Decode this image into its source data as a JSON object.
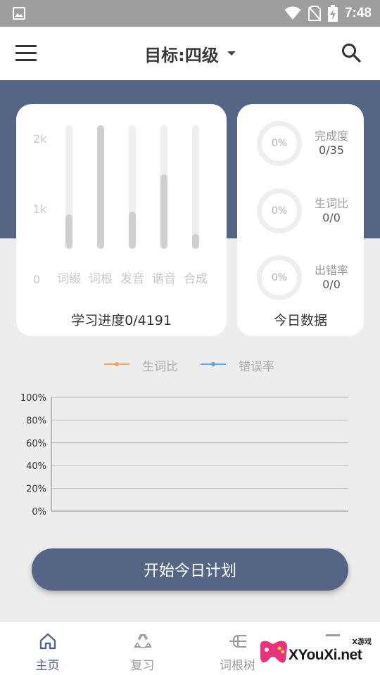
{
  "status_bar": {
    "time": "7:48",
    "icons": [
      "image-icon",
      "wifi-icon",
      "no-sim-icon",
      "battery-charging-icon"
    ]
  },
  "app_bar": {
    "menu_icon": "menu-icon",
    "title": "目标:四级",
    "dropdown_icon": "caret-down-icon",
    "search_icon": "search-icon"
  },
  "progress_card": {
    "y_ticks": [
      "2k",
      "1k",
      "0"
    ],
    "bars": [
      {
        "label": "词缀",
        "fraction": 0.28
      },
      {
        "label": "词根",
        "fraction": 1.0
      },
      {
        "label": "发音",
        "fraction": 0.3
      },
      {
        "label": "谐音",
        "fraction": 0.6
      },
      {
        "label": "合成",
        "fraction": 0.12
      }
    ],
    "caption": "学习进度0/4191"
  },
  "today_card": {
    "stats": [
      {
        "percent": "0%",
        "label": "完成度",
        "value": "0/35"
      },
      {
        "percent": "0%",
        "label": "生词比",
        "value": "0/0"
      },
      {
        "percent": "0%",
        "label": "出错率",
        "value": "0/0"
      }
    ],
    "caption": "今日数据"
  },
  "chart_data": {
    "type": "line",
    "series": [
      {
        "name": "生词比",
        "color": "#f0a35e",
        "values": []
      },
      {
        "name": "错误率",
        "color": "#5aa3e8",
        "values": []
      }
    ],
    "y_ticks": [
      "100%",
      "80%",
      "60%",
      "40%",
      "20%",
      "0%"
    ],
    "ylim": [
      0,
      100
    ],
    "grid": true,
    "legend": "top-center"
  },
  "start_button": {
    "label": "开始今日计划"
  },
  "bottom_nav": [
    {
      "label": "主页",
      "icon": "home-icon",
      "active": true
    },
    {
      "label": "复习",
      "icon": "recycle-icon",
      "active": false
    },
    {
      "label": "词根树",
      "icon": "tree-icon",
      "active": false
    },
    {
      "label": "",
      "icon": "more-icon",
      "active": false
    }
  ],
  "watermark": {
    "small": "X游戏",
    "text": "XYouXi.net"
  },
  "colors": {
    "primary": "#546585",
    "background": "#ededed",
    "card": "#ffffff"
  }
}
